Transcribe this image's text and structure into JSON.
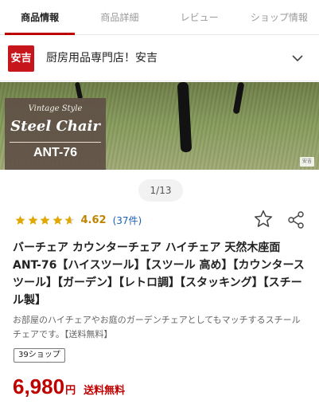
{
  "tabs": [
    {
      "label": "商品情報",
      "active": true
    },
    {
      "label": "商品詳細",
      "active": false
    },
    {
      "label": "レビュー",
      "active": false
    },
    {
      "label": "ショップ情報",
      "active": false
    }
  ],
  "shop": {
    "logo_text": "安吉",
    "name": "厨房用品専門店！安吉",
    "expand_icon": "chevron-down-icon"
  },
  "hero": {
    "line1": "Vintage Style",
    "line2": "Steel Chair",
    "line3": "ANT-76",
    "corner_tag": "安吉"
  },
  "pager": {
    "text": "1/13"
  },
  "rating": {
    "value": "4.62",
    "stars": 4.62,
    "count": "(37件)",
    "star_color": "#e0a800"
  },
  "actions": {
    "favorite_icon": "star-outline-icon",
    "share_icon": "share-icon"
  },
  "title": "バーチェア カウンターチェア ハイチェア 天然木座面 ANT-76【ハイスツール】【スツール 高め】【カウンタースツール】【ガーデン】【レトロ調】【スタッキング】【スチール製】",
  "description": "お部屋のハイチェアやお庭のガーデンチェアとしてもマッチするスチールチェアです。【送料無料】",
  "badge_39": "39ショップ",
  "price": {
    "amount": "6,980",
    "currency": "円",
    "shipping": "送料無料",
    "color": "#bf0000"
  }
}
